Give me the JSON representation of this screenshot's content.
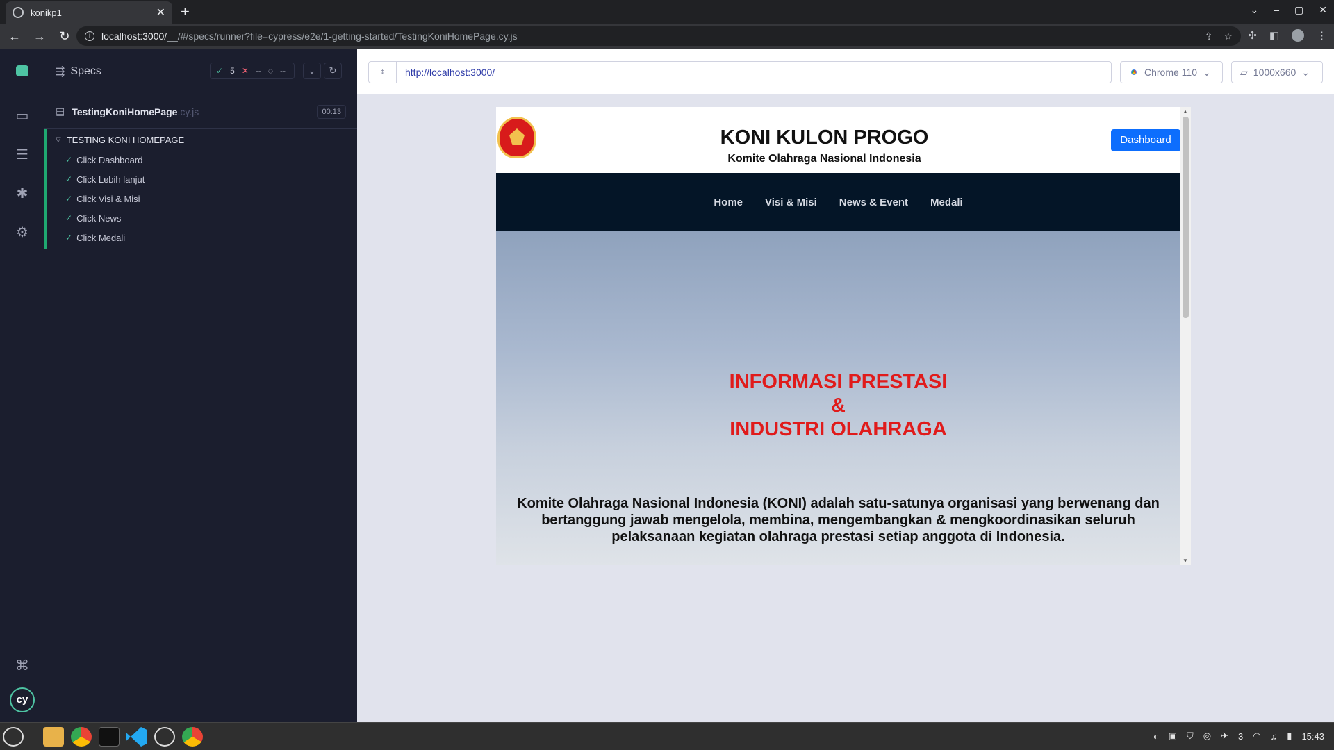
{
  "browser": {
    "tab_title": "konikp1",
    "new_tab_symbol": "+",
    "close_symbol": "✕",
    "url_host": "localhost:3000/",
    "url_rest": "__/#/specs/runner?file=cypress/e2e/1-getting-started/TestingKoniHomePage.cy.js"
  },
  "reporter": {
    "header_label": "Specs",
    "passed": "5",
    "failed": "--",
    "pending": "--",
    "spec_name": "TestingKoniHomePage",
    "spec_ext": ".cy.js",
    "duration": "00:13",
    "suite_title": "TESTING KONI HOMEPAGE",
    "tests": [
      {
        "label": "Click Dashboard"
      },
      {
        "label": "Click Lebih lanjut"
      },
      {
        "label": "Click Visi & Misi"
      },
      {
        "label": "Click News"
      },
      {
        "label": "Click Medali"
      }
    ]
  },
  "aut": {
    "url": "http://localhost:3000/",
    "browser_label": "Chrome 110",
    "viewport_label": "1000x660"
  },
  "site": {
    "title": "KONI KULON PROGO",
    "subtitle": "Komite Olahraga Nasional Indonesia",
    "dashboard_button": "Dashboard",
    "nav": [
      "Home",
      "Visi & Misi",
      "News & Event",
      "Medali"
    ],
    "hero_line1": "INFORMASI PRESTASI",
    "hero_line2": "&",
    "hero_line3": "INDUSTRI OLAHRAGA",
    "hero_desc": "Komite Olahraga Nasional Indonesia (KONI) adalah satu-satunya organisasi yang berwenang dan bertanggung jawab mengelola, membina, mengembangkan & mengkoordinasikan seluruh pelaksanaan kegiatan olahraga prestasi setiap anggota di Indonesia."
  },
  "taskbar": {
    "clock": "15:43",
    "notif_count": "3"
  },
  "colors": {
    "pass": "#4ec4a3",
    "fail": "#fa6577",
    "hero_title": "#e01b1b",
    "nav_bg": "#041527",
    "dashboard_btn": "#0d6efd"
  }
}
